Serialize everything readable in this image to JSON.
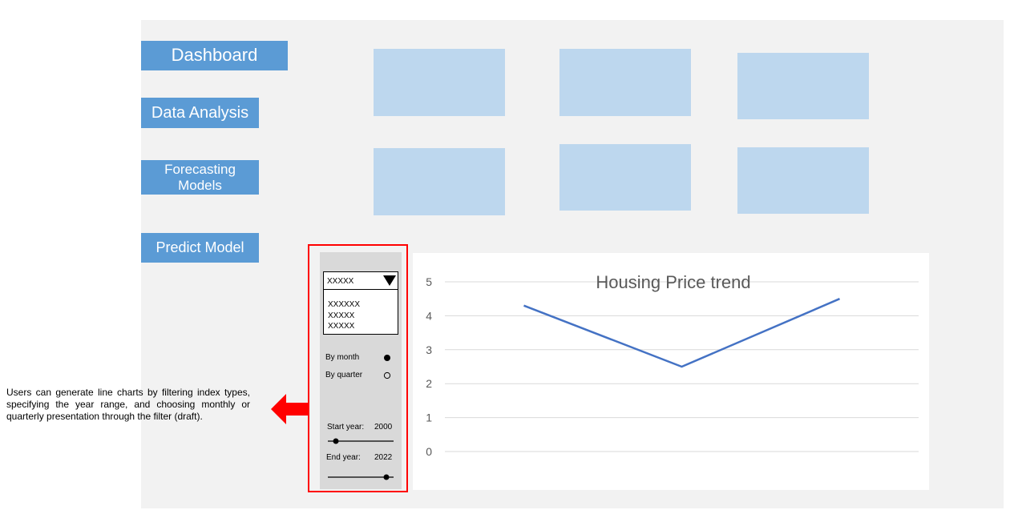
{
  "nav": {
    "items": [
      {
        "label": "Dashboard"
      },
      {
        "label": "Data Analysis"
      },
      {
        "label": "Forecasting Models"
      },
      {
        "label": "Predict Model"
      }
    ]
  },
  "filter": {
    "dropdown": {
      "selected": "XXXXX",
      "options": [
        "XXXXXX",
        "XXXXX",
        "XXXXX"
      ]
    },
    "period": {
      "options": [
        {
          "label": "By month",
          "selected": true
        },
        {
          "label": "By quarter",
          "selected": false
        }
      ]
    },
    "start_year": {
      "label": "Start year:",
      "value": "2000"
    },
    "end_year": {
      "label": "End year:",
      "value": "2022"
    }
  },
  "chart_data": {
    "type": "line",
    "title": "Housing Price trend",
    "x": [
      1,
      2,
      3
    ],
    "series": [
      {
        "values": [
          4.3,
          2.5,
          4.5
        ],
        "color": "#4472c4"
      }
    ],
    "ylim": [
      0,
      5
    ],
    "yticks": [
      "0",
      "1",
      "2",
      "3",
      "4",
      "5"
    ],
    "grid": true
  },
  "annotation": {
    "text": "Users can generate line charts by filtering index types, specifying the year range, and choosing monthly or quarterly presentation through the filter (draft)."
  },
  "colors": {
    "nav_button": "#5b9bd5",
    "card": "#bdd7ee",
    "highlight": "#ff0000",
    "line": "#4472c4"
  }
}
